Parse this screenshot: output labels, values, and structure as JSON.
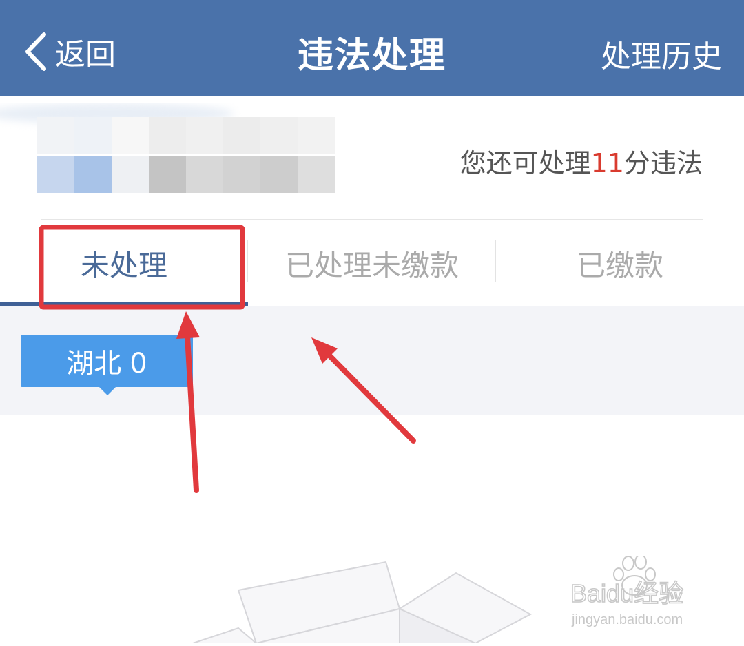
{
  "nav": {
    "back_label": "返回",
    "title": "违法处理",
    "history_label": "处理历史"
  },
  "info": {
    "points_prefix": "您还可处理",
    "points_value": "11",
    "points_suffix": "分违法"
  },
  "tabs": [
    {
      "label": "未处理",
      "active": true
    },
    {
      "label": "已处理未缴款",
      "active": false
    },
    {
      "label": "已缴款",
      "active": false
    }
  ],
  "region_chip": {
    "name": "湖北",
    "count": "0"
  },
  "colors": {
    "nav_bg": "#4a72aa",
    "active_tab": "#4a6a98",
    "chip_bg": "#4b9be9",
    "highlight_red": "#e1393d",
    "points_red": "#d93b2f"
  },
  "watermark": {
    "brand": "Baidu经验",
    "url": "jingyan.baidu.com"
  }
}
